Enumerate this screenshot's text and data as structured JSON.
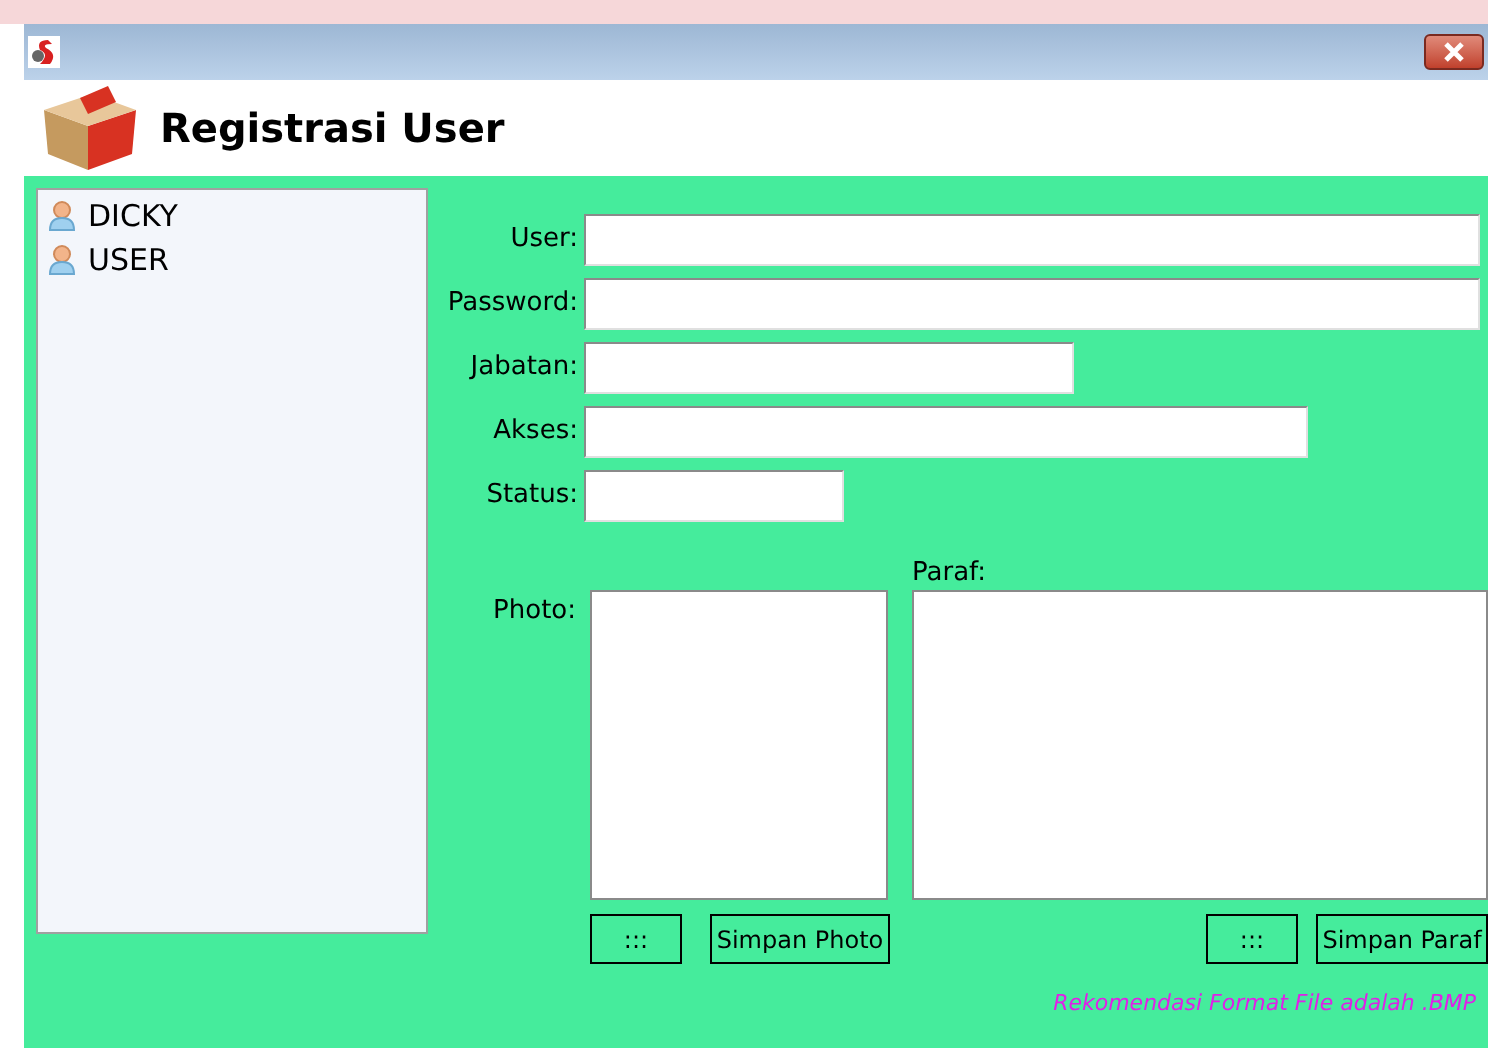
{
  "window": {
    "title": "Registrasi User"
  },
  "users": [
    {
      "name": "DICKY"
    },
    {
      "name": "USER"
    }
  ],
  "fields": [
    {
      "label": "User:"
    },
    {
      "label": "Password:"
    },
    {
      "label": "Jabatan:"
    },
    {
      "label": "Akses:"
    },
    {
      "label": "Status:"
    }
  ],
  "photo": {
    "label": "Photo:",
    "browse": ":::",
    "save": "Simpan Photo"
  },
  "paraf": {
    "label": "Paraf:",
    "browse": ":::",
    "save": "Simpan Paraf"
  },
  "note": "Rekomendasi Format File adalah .BMP"
}
